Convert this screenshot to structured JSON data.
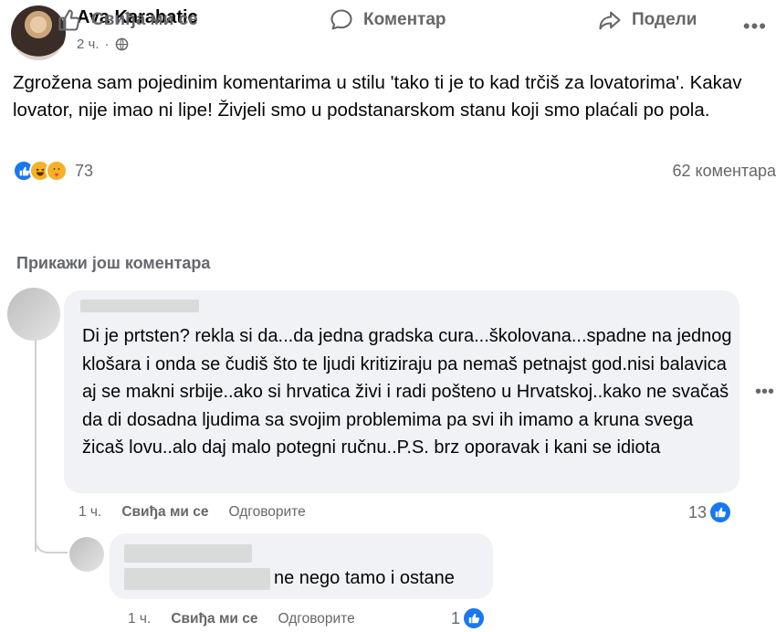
{
  "post": {
    "author": "Ava Karabatic",
    "time": "2 ч.",
    "separator": "·",
    "text": "Zgrožena sam pojedinim komentarima u stilu 'tako ti je to kad trčiš za lovatorima'. Kakav lovator, nije imao ni lipe! Živjeli smo u podstanarskom stanu koji smo plaćali po pola.",
    "reaction_count": "73",
    "comments_count": "62 коментара",
    "icons": [
      "globe-icon",
      "like-reaction-icon",
      "haha-reaction-icon",
      "care-reaction-icon",
      "more-icon"
    ]
  },
  "actions": {
    "like": "Свиђа ми се",
    "comment": "Коментар",
    "share": "Подели"
  },
  "more_comments": "Прикажи још коментара",
  "comments": [
    {
      "text": "Di je prtsten? rekla si da...da jedna gradska cura...školovana...spadne na jednog klošara i onda se čudiš što te ljudi kritiziraju pa nemaš petnajst god.nisi balavica aj se makni srbije..ako si hrvatica živi i radi pošteno u Hrvatskoj..kako ne svačaš da di dosadna ljudima sa svojim problemima pa svi ih imamo a kruna svega žicaš lovu..alo daj malo potegni ručnu..P.S. brz oporavak i kani se idiota",
      "time": "1 ч.",
      "like": "Свиђа ми се",
      "reply": "Одговорите",
      "reactions": "13"
    },
    {
      "text": "ne nego tamo i ostane",
      "time": "1 ч.",
      "like": "Свиђа ми се",
      "reply": "Одговорите",
      "reactions": "1"
    }
  ],
  "colors": {
    "text": "#050505",
    "secondary": "#65676b",
    "accent": "#1877f2",
    "bubble": "#f0f2f5"
  }
}
